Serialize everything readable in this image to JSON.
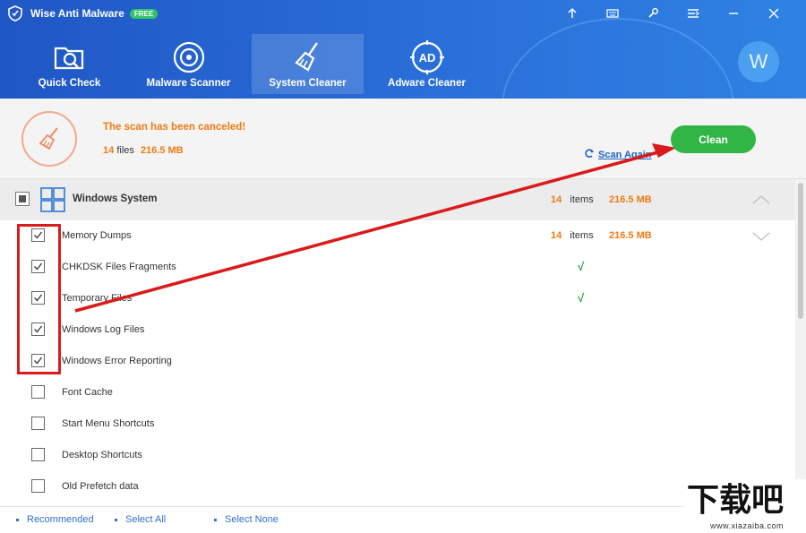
{
  "app": {
    "title": "Wise Anti Malware",
    "badge": "FREE"
  },
  "window_controls": [
    "upload-icon",
    "keyboard-icon",
    "settings-icon",
    "menu-icon",
    "minimize-icon",
    "close-icon"
  ],
  "nav": {
    "tabs": [
      {
        "label": "Quick Check",
        "icon": "folder-search-icon",
        "active": false
      },
      {
        "label": "Malware Scanner",
        "icon": "radar-icon",
        "active": false
      },
      {
        "label": "System Cleaner",
        "icon": "broom-icon",
        "active": true
      },
      {
        "label": "Adware Cleaner",
        "icon": "ad-icon",
        "active": false
      }
    ],
    "avatar_letter": "W"
  },
  "status": {
    "message": "The scan has been canceled!",
    "files_count": "14",
    "files_label": "files",
    "size": "216.5 MB",
    "scan_again": "Scan Again",
    "clean_button": "Clean"
  },
  "category": {
    "name": "Windows System",
    "count": "14",
    "count_label": "items",
    "size": "216.5 MB"
  },
  "items": [
    {
      "label": "Memory Dumps",
      "checked": true,
      "count": "14",
      "count_label": "items",
      "size": "216.5 MB",
      "tick": ""
    },
    {
      "label": "CHKDSK Files Fragments",
      "checked": true,
      "tick": "√"
    },
    {
      "label": "Temporary Files",
      "checked": true,
      "tick": "√"
    },
    {
      "label": "Windows Log Files",
      "checked": true,
      "tick": ""
    },
    {
      "label": "Windows Error Reporting",
      "checked": true,
      "tick": ""
    },
    {
      "label": "Font Cache",
      "checked": false,
      "tick": ""
    },
    {
      "label": "Start Menu Shortcuts",
      "checked": false,
      "tick": ""
    },
    {
      "label": "Desktop Shortcuts",
      "checked": false,
      "tick": ""
    },
    {
      "label": "Old Prefetch data",
      "checked": false,
      "tick": ""
    }
  ],
  "footer": {
    "recommended": "Recommended",
    "select_all": "Select All",
    "select_none": "Select None"
  },
  "watermark": {
    "text": "下载吧",
    "url": "www.xiazaiba.com"
  },
  "colors": {
    "header": "#2a6fd9",
    "accent_orange": "#ef7a11",
    "clean_green": "#31b645",
    "annotation_red": "#d91b1b"
  }
}
